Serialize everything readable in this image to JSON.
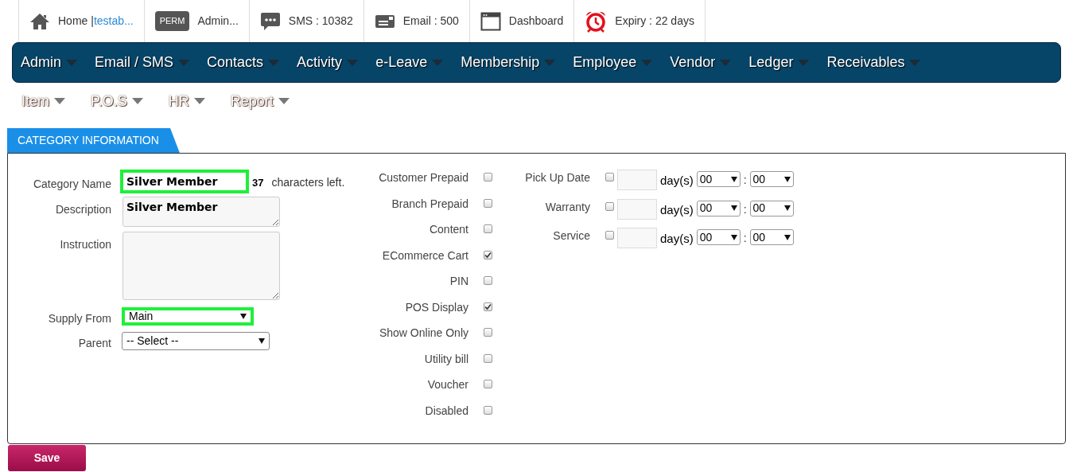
{
  "top_bar": [
    {
      "kind": "home",
      "text": "Home | ",
      "link": "testab..."
    },
    {
      "kind": "perm",
      "badge": "PERM",
      "text": "Admin..."
    },
    {
      "kind": "sms",
      "text": "SMS : 10382"
    },
    {
      "kind": "email",
      "text": "Email : 500"
    },
    {
      "kind": "dashboard",
      "text": "Dashboard"
    },
    {
      "kind": "expiry",
      "text": "Expiry : 22 days"
    }
  ],
  "main_menu": [
    "Admin",
    "Email / SMS",
    "Contacts",
    "Activity",
    "e-Leave",
    "Membership",
    "Employee",
    "Vendor",
    "Ledger",
    "Receivables"
  ],
  "sub_menu": [
    "Item",
    "P.O.S",
    "HR",
    "Report"
  ],
  "tab": {
    "label": "CATEGORY INFORMATION"
  },
  "left_fields": [
    {
      "kind": "text",
      "label": "Category Name",
      "value": "Silver Member",
      "highlighted": true,
      "counter": "37",
      "counter_text": "characters left."
    },
    {
      "kind": "textarea",
      "label": "Description",
      "value": "Silver Member",
      "highlighted": false
    },
    {
      "kind": "textarea_tall",
      "label": "Instruction",
      "highlighted": false
    },
    {
      "kind": "select",
      "label": "Supply From",
      "value": "Main",
      "highlighted": true
    },
    {
      "kind": "select",
      "label": "Parent",
      "value": "-- Select --",
      "highlighted": false
    }
  ],
  "options": [
    {
      "label": "Customer Prepaid",
      "checked": false
    },
    {
      "label": "Branch Prepaid",
      "checked": false
    },
    {
      "label": "Content",
      "checked": false
    },
    {
      "label": "ECommerce Cart",
      "checked": true
    },
    {
      "label": "PIN",
      "checked": false
    },
    {
      "label": "POS Display",
      "checked": true
    },
    {
      "label": "Show Online Only",
      "checked": false
    },
    {
      "label": "Utility bill",
      "checked": false
    },
    {
      "label": "Voucher",
      "checked": false
    },
    {
      "label": "Disabled",
      "checked": false
    }
  ],
  "durations": [
    {
      "label": "Pick Up Date",
      "checked": false,
      "unit": "day(s)",
      "hours": "00",
      "separator": ":",
      "minutes": "00"
    },
    {
      "label": "Warranty",
      "checked": false,
      "unit": "day(s)",
      "hours": "00",
      "separator": ":",
      "minutes": "00"
    },
    {
      "label": "Service",
      "checked": false,
      "unit": "day(s)",
      "hours": "00",
      "separator": ":",
      "minutes": "00"
    }
  ],
  "save_button": "Save"
}
